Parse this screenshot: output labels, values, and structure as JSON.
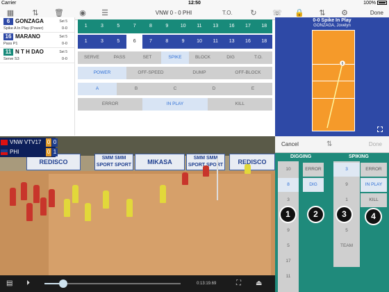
{
  "status_bar": {
    "carrier": "Carrier",
    "time": "12:50",
    "battery": "100%"
  },
  "nav": {
    "match_title": "VNW 0 - 0 PHI",
    "to_label": "T.O.",
    "done_label": "Done",
    "icons": [
      "grid-icon",
      "sort-icon",
      "trash-icon",
      "stop-icon",
      "list-icon",
      "swap-icon",
      "whistle-icon",
      "lock-icon",
      "sort-icon",
      "gear-icon"
    ]
  },
  "log": [
    {
      "number": "6",
      "color": "#2e49a6",
      "name": "GONZAGA",
      "set": "Set 5",
      "desc": "Spike A In Play (Power)",
      "score": "0-0"
    },
    {
      "number": "16",
      "color": "#2e49a6",
      "name": "MARANO",
      "set": "Set 5",
      "desc": "Pass P1",
      "score": "0-0"
    },
    {
      "number": "11",
      "color": "#188a7a",
      "name": "N T H DAO",
      "set": "Set 5",
      "desc": "Serve S3",
      "score": "0-0"
    }
  ],
  "rotation_top": [
    "1",
    "3",
    "5",
    "7",
    "8",
    "9",
    "10",
    "11",
    "13",
    "16",
    "17",
    "18"
  ],
  "rotation_bottom": {
    "items": [
      "1",
      "3",
      "5",
      "6",
      "7",
      "8",
      "9",
      "10",
      "11",
      "13",
      "16",
      "18"
    ],
    "selected": 3
  },
  "action_row": {
    "items": [
      "SERVE",
      "PASS",
      "SET",
      "SPIKE",
      "BLOCK",
      "DIG",
      "T.O."
    ],
    "selected": 3
  },
  "sub_row": {
    "items": [
      "POWER",
      "OFF-SPEED",
      "DUMP",
      "OFF-BLOCK"
    ],
    "selected": 0
  },
  "zone_row": {
    "items": [
      "A",
      "B",
      "C",
      "D",
      "E"
    ],
    "selected": 0
  },
  "result_row": {
    "items": [
      "ERROR",
      "IN PLAY",
      "KILL"
    ],
    "selected": 1
  },
  "court": {
    "title": "0-0 Spike  In Play",
    "subtitle": "GONZAGA, Jovelyn",
    "marker_label": "6"
  },
  "video": {
    "teams": [
      {
        "name": "VNW VTV17",
        "s1": "0",
        "s2": "0"
      },
      {
        "name": "PHI",
        "s1": "0",
        "s2": "1"
      }
    ],
    "banners": [
      "REDISCO",
      "SMM SMM",
      "MIKASA",
      "SMM SMM",
      "REDISCO"
    ],
    "sponsor_lines": [
      "SPORT SPORT",
      "SPORT SPORT"
    ],
    "time": "0:13:19.69",
    "progress": 0.14
  },
  "selector": {
    "cancel_label": "Cancel",
    "done_label": "Done",
    "digging_label": "DIGGING",
    "spiking_label": "SPIKING",
    "col1": [
      "10",
      "8",
      "3",
      "6",
      "9",
      "5",
      "17",
      "11"
    ],
    "col1_selected": 1,
    "col2": [
      "ERROR",
      "DIG"
    ],
    "col2_selected": 1,
    "col3": [
      "3",
      "9",
      "1",
      "16",
      "5",
      "TEAM"
    ],
    "col3_selected": 0,
    "col4": [
      "ERROR",
      "IN PLAY",
      "KILL"
    ],
    "col4_selected": 1,
    "badges": [
      "1",
      "2",
      "3",
      "4"
    ]
  }
}
